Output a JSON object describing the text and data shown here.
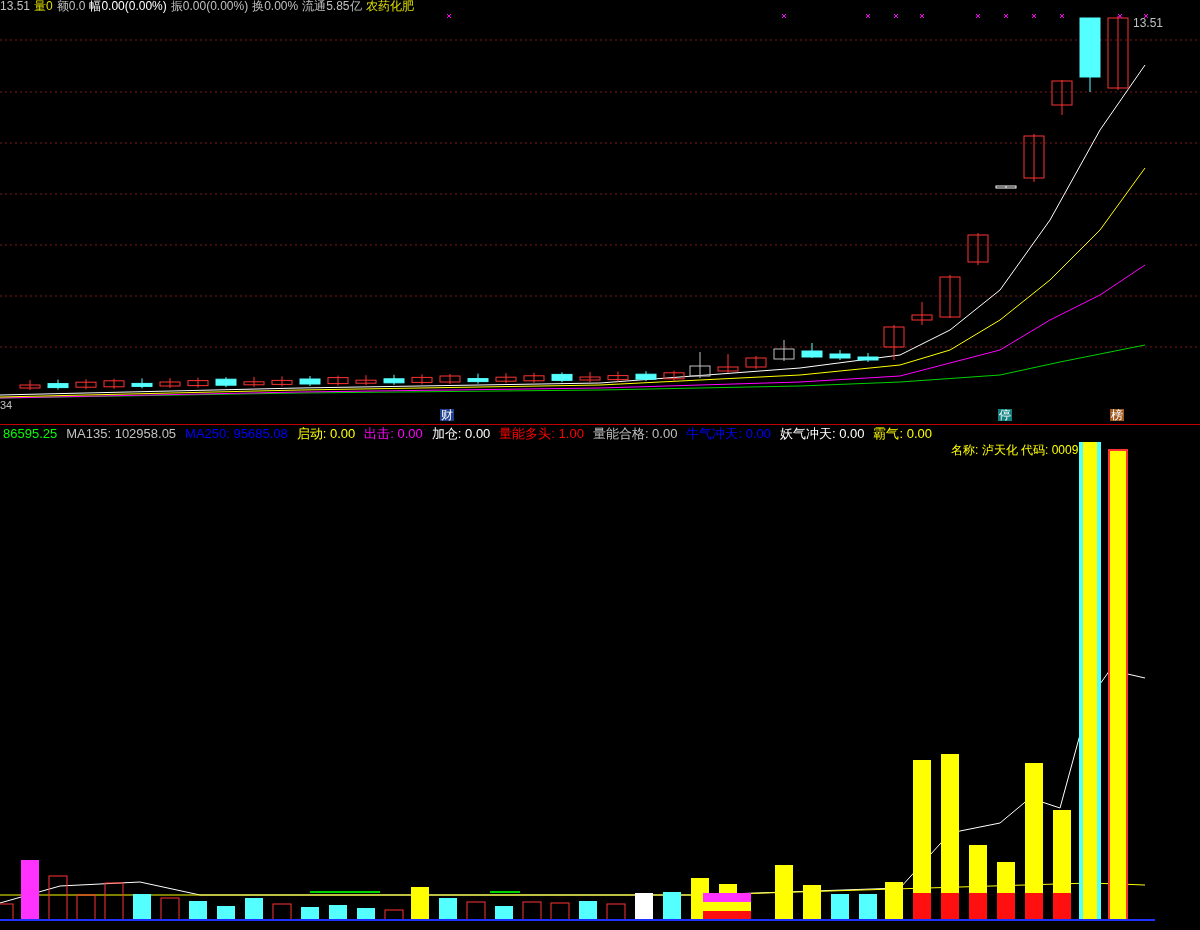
{
  "price_panel": {
    "header": [
      {
        "text": "13.51",
        "color": "#c0c0c0"
      },
      {
        "text": "量0",
        "color": "#e0e000"
      },
      {
        "text": "额0.0",
        "color": "#c0c0c0"
      },
      {
        "text": "幅0.00(0.00%)",
        "color": "#ffffff"
      },
      {
        "text": "振0.00(0.00%)",
        "color": "#c0c0c0"
      },
      {
        "text": "换0.00%",
        "color": "#c0c0c0"
      },
      {
        "text": "流通5.85亿",
        "color": "#c0c0c0"
      },
      {
        "text": "农药化肥",
        "color": "#e0e000"
      }
    ],
    "last_price": "13.51",
    "low_label": "34",
    "markers": [
      {
        "text": "财",
        "color": "#1f3f8f"
      },
      {
        "text": "停",
        "color": "#138080"
      },
      {
        "text": "榜",
        "color": "#a05a20"
      }
    ]
  },
  "indicator_panel": {
    "legend": [
      {
        "text": "86595.25",
        "color": "#00ff00"
      },
      {
        "text": "MA135: 102958.05",
        "color": "#c0c0c0"
      },
      {
        "text": "MA250: 95685.08",
        "color": "#0000ff"
      },
      {
        "text": "启动: 0.00",
        "color": "#ffff00"
      },
      {
        "text": "出击: 0.00",
        "color": "#ff00ff"
      },
      {
        "text": "加仓: 0.00",
        "color": "#ffffff"
      },
      {
        "text": "量能多头: 1.00",
        "color": "#ff0000"
      },
      {
        "text": "量能合格: 0.00",
        "color": "#c0c0c0"
      },
      {
        "text": "牛气冲天: 0.00",
        "color": "#0000ff"
      },
      {
        "text": "妖气冲天: 0.00",
        "color": "#ffffff"
      },
      {
        "text": "霸气: 0.00",
        "color": "#ffff00"
      }
    ],
    "name_label": "名称: 泸天化 代码: 0009"
  }
}
